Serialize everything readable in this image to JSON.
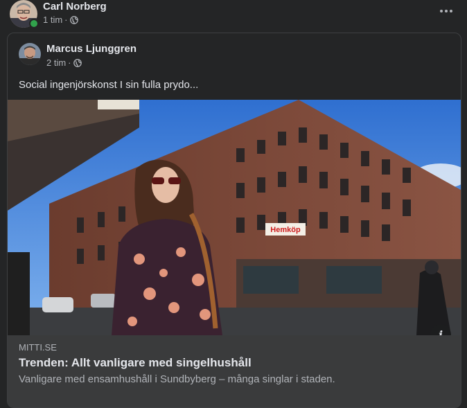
{
  "post": {
    "author": "Carl Norberg",
    "time": "1 tim",
    "privacy_icon": "globe-icon",
    "more_icon": "more-options-icon"
  },
  "shared_post": {
    "author": "Marcus Ljunggren",
    "time": "2 tim",
    "privacy_icon": "globe-icon",
    "text": "Social ingenjörskonst I sin fulla prydo..."
  },
  "link_preview": {
    "domain": "MITTI.SE",
    "title": "Trenden: Allt vanligare med singelhushåll",
    "description": "Vanligare med ensamhushåll i Sundbyberg – många singlar i staden.",
    "info_icon": "info-icon"
  },
  "photo": {
    "store_sign": "Hemköp"
  },
  "colors": {
    "background": "#242526",
    "online": "#31a24c"
  }
}
